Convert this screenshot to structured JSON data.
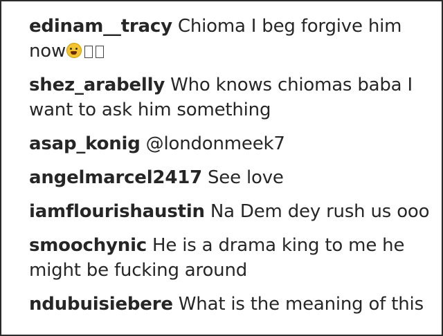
{
  "comments": [
    {
      "username": "edinam__tracy",
      "text": "Chioma I beg forgive him now",
      "emoji": "tired-face-icon",
      "trailing_glyphs": 2
    },
    {
      "username": "shez_arabelly",
      "text": "Who knows chiomas baba I want to ask him something"
    },
    {
      "username": "asap_konig",
      "text": "@londonmeek7"
    },
    {
      "username": "angelmarcel2417",
      "text": "See love"
    },
    {
      "username": "iamflourishaustin",
      "text": "Na Dem dey rush us ooo"
    },
    {
      "username": "smoochynic",
      "text": "He is a drama king to me he might be fucking around"
    },
    {
      "username": "ndubuisiebere",
      "text": "What is the meaning of this"
    }
  ]
}
